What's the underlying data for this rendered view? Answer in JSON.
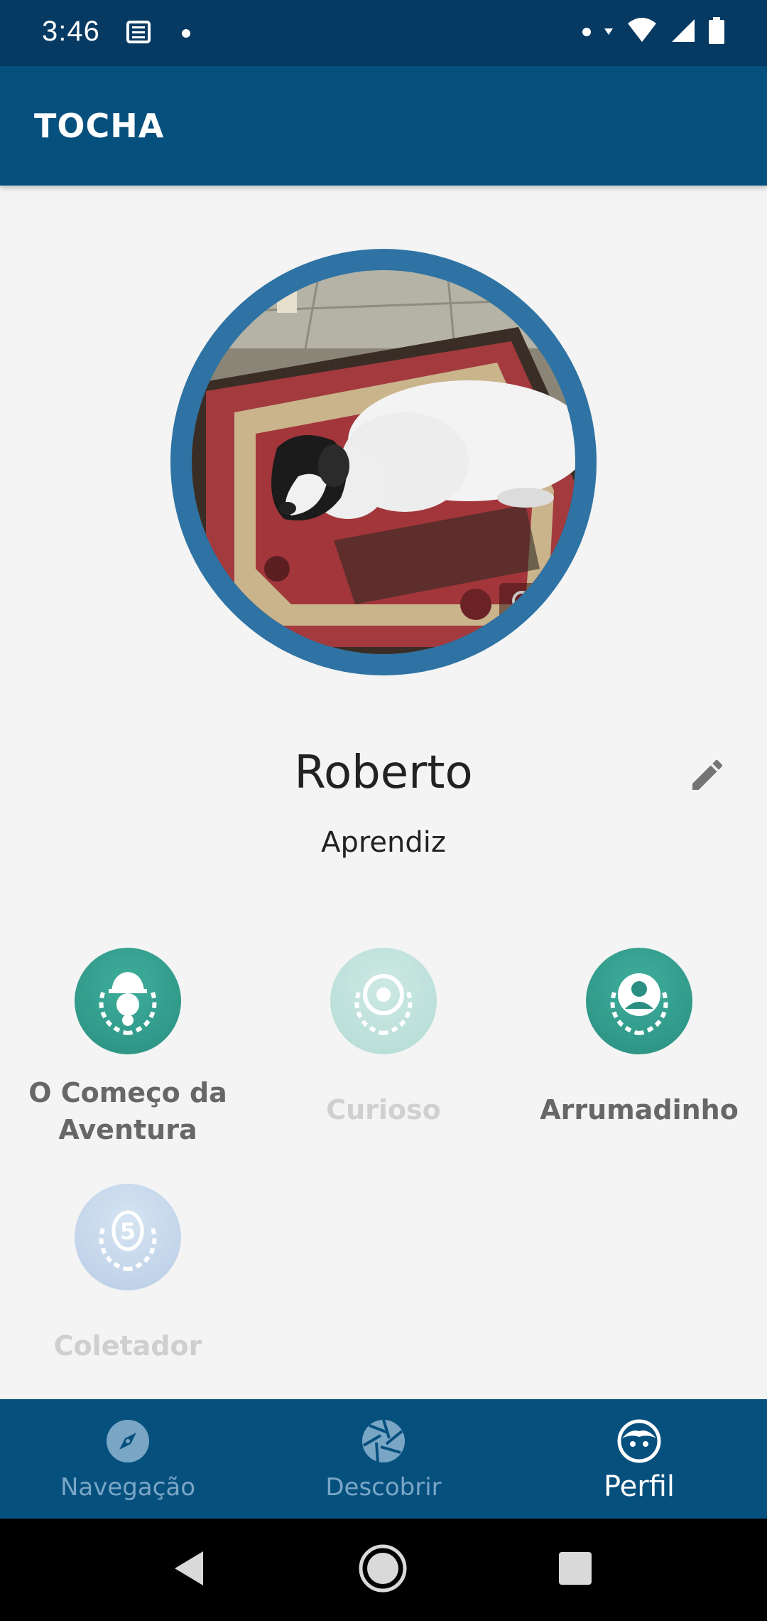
{
  "status_bar": {
    "time": "3:46"
  },
  "app_bar": {
    "title": "TOCHA"
  },
  "profile": {
    "name": "Roberto",
    "rank": "Aprendiz"
  },
  "badges": [
    {
      "label": "O Começo da Aventura",
      "state": "earned",
      "icon": "explorer-icon"
    },
    {
      "label": "Curioso",
      "state": "locked",
      "icon": "aperture-icon"
    },
    {
      "label": "Arrumadinho",
      "state": "earned",
      "icon": "person-icon"
    },
    {
      "label": "Coletador",
      "state": "locked",
      "icon": "five-icon",
      "number": "5"
    }
  ],
  "bottom_nav": {
    "items": [
      {
        "label": "Navegação",
        "icon": "compass-icon",
        "active": false
      },
      {
        "label": "Descobrir",
        "icon": "aperture-icon",
        "active": false
      },
      {
        "label": "Perfil",
        "icon": "face-icon",
        "active": true
      }
    ]
  },
  "colors": {
    "status_bar": "#063a63",
    "app_bar": "#06507e",
    "avatar_ring": "#2e73a4",
    "badge_active": "#3fae9c",
    "background": "#f4f4f4"
  }
}
